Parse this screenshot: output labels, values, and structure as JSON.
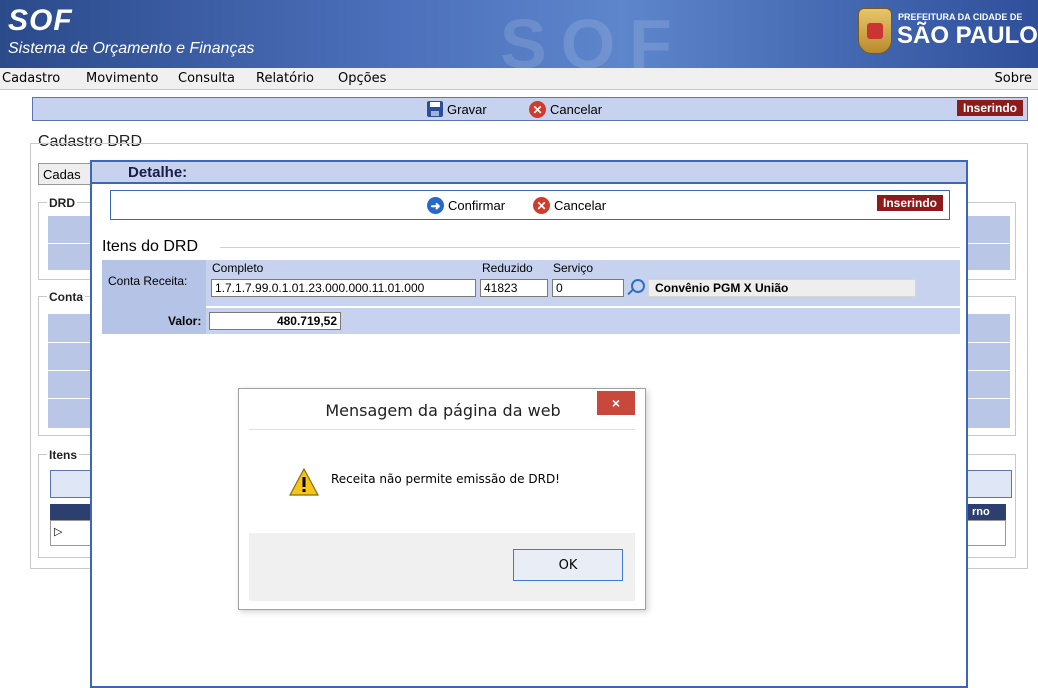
{
  "header": {
    "app_short": "SOF",
    "app_name": "Sistema de Orçamento e Finanças",
    "watermark": "SOF",
    "city_small": "PREFEITURA DA CIDADE DE",
    "city_big": "SÃO PAULO"
  },
  "menu": {
    "items": [
      "Cadastro",
      "Movimento",
      "Consulta",
      "Relatório",
      "Opções"
    ],
    "right": "Sobre"
  },
  "toolbar": {
    "save_label": "Gravar",
    "cancel_label": "Cancelar",
    "status": "Inserindo"
  },
  "background": {
    "title": "Cadastro DRD",
    "tab": "Cadas",
    "section_drd": "DRD",
    "section_conta": "Conta",
    "section_itens": "Itens",
    "col_partial": "rno"
  },
  "detail": {
    "title": "Detalhe:",
    "confirm_label": "Confirmar",
    "cancel_label": "Cancelar",
    "status": "Inserindo",
    "section": "Itens do DRD",
    "conta_label": "Conta Receita:",
    "completo_label": "Completo",
    "completo_value": "1.7.1.7.99.0.1.01.23.000.000.11.01.000",
    "reduzido_label": "Reduzido",
    "reduzido_value": "41823",
    "servico_label": "Serviço",
    "servico_value": "0",
    "conta_desc": "Convênio PGM X União",
    "valor_label": "Valor:",
    "valor_value": "480.719,52"
  },
  "dialog": {
    "title": "Mensagem da página da web",
    "close": "×",
    "message": "Receita não permite emissão de DRD!",
    "ok": "OK"
  },
  "colors": {
    "header_blue": "#3c5ea8",
    "toolbar_bg": "#c7d3ee",
    "status_bg": "#8c1c1c",
    "dialog_close": "#c8483b"
  }
}
